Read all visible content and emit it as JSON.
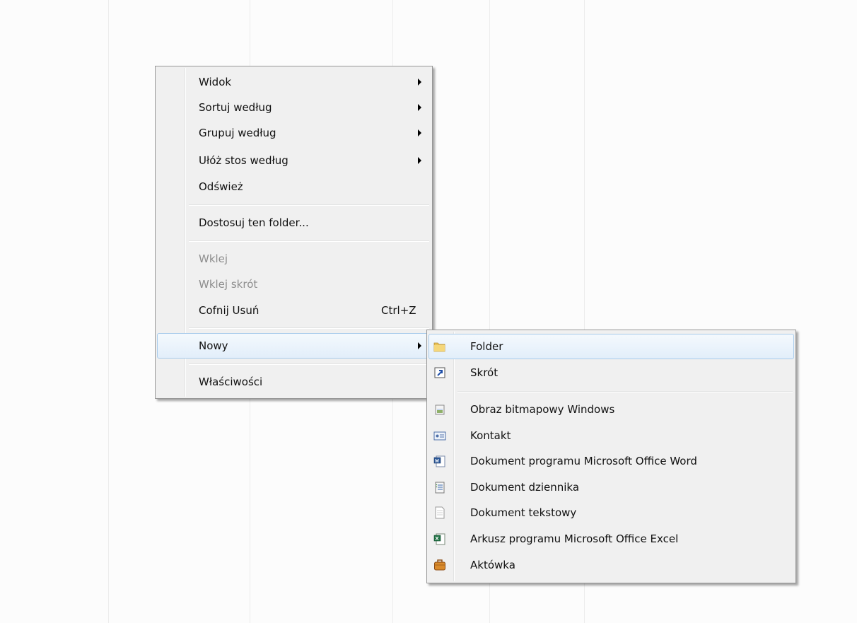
{
  "context_menu": {
    "items": [
      {
        "label": "Widok"
      },
      {
        "label": "Sortuj według"
      },
      {
        "label": "Grupuj według"
      },
      {
        "label": "Ułóż stos według"
      },
      {
        "label": "Odśwież"
      },
      {
        "label": "Dostosuj ten folder..."
      },
      {
        "label": "Wklej"
      },
      {
        "label": "Wklej skrót"
      },
      {
        "label": "Cofnij Usuń",
        "shortcut": "Ctrl+Z"
      },
      {
        "label": "Nowy"
      },
      {
        "label": "Właściwości"
      }
    ]
  },
  "submenu": {
    "items": [
      {
        "label": "Folder",
        "icon": "folder-icon"
      },
      {
        "label": "Skrót",
        "icon": "shortcut-icon"
      },
      {
        "label": "Obraz bitmapowy Windows",
        "icon": "bitmap-icon"
      },
      {
        "label": "Kontakt",
        "icon": "contact-icon"
      },
      {
        "label": "Dokument programu Microsoft Office Word",
        "icon": "word-document-icon"
      },
      {
        "label": "Dokument dziennika",
        "icon": "journal-document-icon"
      },
      {
        "label": "Dokument tekstowy",
        "icon": "text-document-icon"
      },
      {
        "label": "Arkusz programu Microsoft Office Excel",
        "icon": "excel-sheet-icon"
      },
      {
        "label": "Aktówka",
        "icon": "briefcase-icon"
      }
    ]
  },
  "colors": {
    "menu_background": "#f0f0f0",
    "hover_border": "#a8cbeb",
    "disabled_text": "#8d8d8d"
  }
}
